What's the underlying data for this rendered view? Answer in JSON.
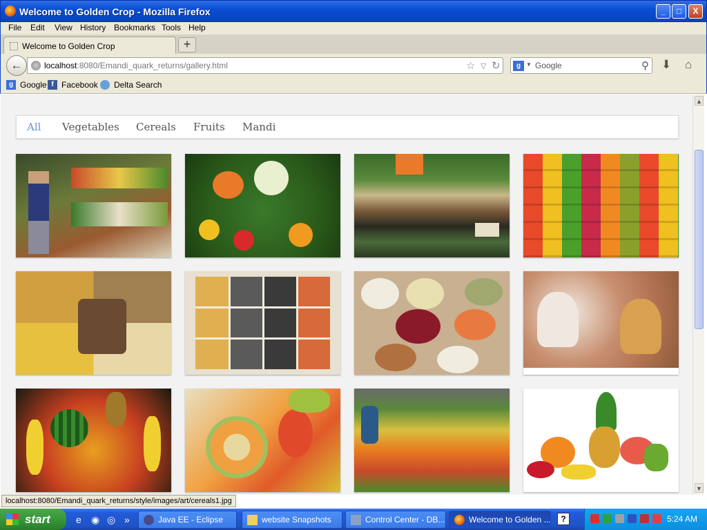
{
  "window": {
    "title": "Welcome to Golden Crop - Mozilla Firefox",
    "minimize": "_",
    "maximize": "□",
    "close": "X"
  },
  "menu": [
    "File",
    "Edit",
    "View",
    "History",
    "Bookmarks",
    "Tools",
    "Help"
  ],
  "tab": {
    "label": "Welcome to Golden Crop",
    "new_tab": "+"
  },
  "address": {
    "host": "localhost",
    "path": ":8080/Emandi_quark_returns/gallery.html"
  },
  "search": {
    "engine": "g",
    "placeholder": "Google"
  },
  "bookmarks": [
    {
      "label": "Google",
      "icon": "google-icon",
      "color": "#3b6fd6"
    },
    {
      "label": "Facebook",
      "icon": "facebook-icon",
      "color": "#3b5998"
    },
    {
      "label": "Delta Search",
      "icon": "delta-search-icon",
      "color": "#6aa0d8"
    }
  ],
  "filters": {
    "items": [
      "All",
      "Vegetables",
      "Cereals",
      "Fruits",
      "Mandi"
    ],
    "active": "All",
    "active_color": "#6b8fd0"
  },
  "gallery": [
    {
      "name": "vegetable-aisle-photo",
      "category": "Vegetables"
    },
    {
      "name": "mixed-vegetables-photo",
      "category": "Vegetables"
    },
    {
      "name": "vegetable-market-shelf-photo",
      "category": "Vegetables"
    },
    {
      "name": "colorful-produce-collage-photo",
      "category": "Vegetables"
    },
    {
      "name": "grain-varieties-photo",
      "category": "Cereals"
    },
    {
      "name": "lentils-box-photo",
      "category": "Cereals"
    },
    {
      "name": "sacks-of-beans-photo",
      "category": "Cereals"
    },
    {
      "name": "bean-piles-photo",
      "category": "Cereals"
    },
    {
      "name": "fruit-assortment-photo",
      "category": "Fruits"
    },
    {
      "name": "tropical-fruits-photo",
      "category": "Fruits"
    },
    {
      "name": "fruit-market-stall-photo",
      "category": "Mandi"
    },
    {
      "name": "fruit-arrangement-photo",
      "category": "Fruits"
    }
  ],
  "status": {
    "text": "localhost:8080/Emandi_quark_returns/style/images/art/cereals1.jpg"
  },
  "taskbar": {
    "start": "start",
    "quick_launch_more": "»",
    "tasks": [
      {
        "label": "Java EE - Eclipse",
        "icon": "eclipse-icon"
      },
      {
        "label": "website Snapshots",
        "icon": "folder-icon"
      },
      {
        "label": "Control Center - DB...",
        "icon": "control-center-icon"
      },
      {
        "label": "Welcome to Golden ...",
        "icon": "firefox-icon"
      }
    ],
    "help": "?",
    "clock": "5:24 AM"
  }
}
